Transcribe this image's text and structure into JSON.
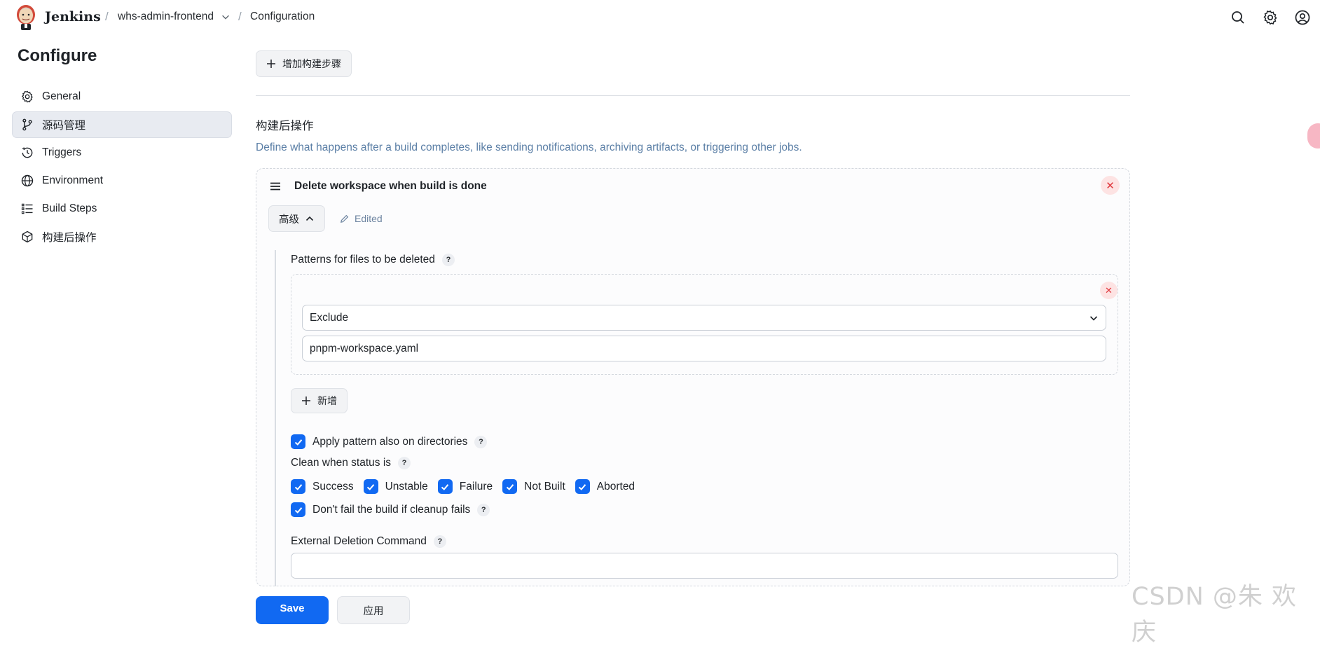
{
  "header": {
    "brand": "Jenkins",
    "breadcrumb": [
      {
        "label": "whs-admin-frontend"
      },
      {
        "label": "Configuration"
      }
    ]
  },
  "sidebar": {
    "title": "Configure",
    "items": [
      {
        "label": "General",
        "icon": "gear-icon",
        "active": false
      },
      {
        "label": "源码管理",
        "icon": "git-branch-icon",
        "active": true
      },
      {
        "label": "Triggers",
        "icon": "clock-icon",
        "active": false
      },
      {
        "label": "Environment",
        "icon": "globe-icon",
        "active": false
      },
      {
        "label": "Build Steps",
        "icon": "list-icon",
        "active": false
      },
      {
        "label": "构建后操作",
        "icon": "cube-icon",
        "active": false
      }
    ]
  },
  "main": {
    "add_build_step": "增加构建步骤",
    "post_build": {
      "title": "构建后操作",
      "description": "Define what happens after a build completes, like sending notifications, archiving artifacts, or triggering other jobs."
    },
    "card": {
      "title": "Delete workspace when build is done",
      "advanced_label": "高级",
      "edited_label": "Edited",
      "patterns_label": "Patterns for files to be deleted",
      "pattern": {
        "type_selected": "Exclude",
        "value": "pnpm-workspace.yaml"
      },
      "add_label": "新增",
      "apply_dirs_label": "Apply pattern also on directories",
      "clean_status_label": "Clean when status is",
      "statuses": [
        {
          "label": "Success",
          "checked": true
        },
        {
          "label": "Unstable",
          "checked": true
        },
        {
          "label": "Failure",
          "checked": true
        },
        {
          "label": "Not Built",
          "checked": true
        },
        {
          "label": "Aborted",
          "checked": true
        }
      ],
      "dont_fail_label": "Don't fail the build if cleanup fails",
      "external_cmd_label": "External Deletion Command",
      "external_cmd_value": ""
    }
  },
  "footer": {
    "save_label": "Save",
    "apply_label": "应用"
  },
  "watermark": "CSDN @朱 欢 庆",
  "colors": {
    "accent": "#1169f2",
    "danger": "#e0383e",
    "muted_link": "#5b7fa6"
  }
}
